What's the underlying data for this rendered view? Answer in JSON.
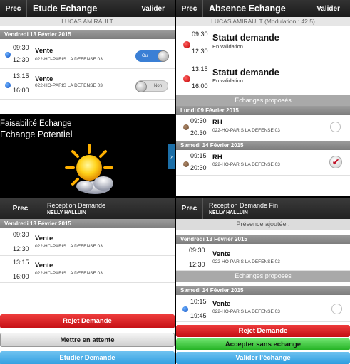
{
  "q1": {
    "prev": "Prec",
    "title": "Etude Echange",
    "validate": "Valider",
    "name": "LUCAS AMIRAULT",
    "day": "Vendredi 13 Février 2015",
    "rows": [
      {
        "t1": "09:30",
        "t2": "12:30",
        "name": "Vente",
        "addr": "022-HO-PARIS LA DEFENSE 03",
        "toggle": "Oui"
      },
      {
        "t1": "13:15",
        "t2": "16:00",
        "name": "Vente",
        "addr": "022-HO-PARIS LA DEFENSE 03",
        "toggle": "Non"
      }
    ]
  },
  "q2": {
    "prev": "Prec",
    "title": "Absence Echange",
    "validate": "Valider",
    "name": "LUCAS AMIRAULT (Modulation : 42.5)",
    "status": [
      {
        "t1": "09:30",
        "t2": "12:30",
        "title": "Statut demande",
        "sub": "En validation"
      },
      {
        "t1": "13:15",
        "t2": "16:00",
        "title": "Statut demande",
        "sub": "En validation"
      }
    ],
    "section": "Echanges proposés",
    "days": [
      {
        "day": "Lundi 09 Février 2015",
        "t1": "09:30",
        "t2": "20:30",
        "name": "RH",
        "addr": "022-HO-PARIS LA DEFENSE 03"
      },
      {
        "day": "Samedi 14 Février 2015",
        "t1": "09:15",
        "t2": "20:30",
        "name": "RH",
        "addr": "022-HO-PARIS LA DEFENSE 03"
      }
    ]
  },
  "q3": {
    "line1": "Faisabilité Echange",
    "line2": "Echange Potentiel",
    "arrow": "›"
  },
  "q4": {
    "prev": "Prec",
    "title": "Reception Demande",
    "person": "NELLY HALLUIN",
    "day": "Vendredi 13 Février 2015",
    "rows": [
      {
        "t1": "09:30",
        "t2": "12:30",
        "name": "Vente",
        "addr": "022-HO-PARIS LA DEFENSE 03"
      },
      {
        "t1": "13:15",
        "t2": "16:00",
        "name": "Vente",
        "addr": "022-HO-PARIS LA DEFENSE 03"
      }
    ],
    "btn_reject": "Rejet Demande",
    "btn_wait": "Mettre en attente",
    "btn_study": "Etudier Demande"
  },
  "q5": {
    "prev": "Prec",
    "title": "Reception Demande Fin",
    "person": "NELLY HALLUIN",
    "presence": "Présence ajoutée :",
    "day1": "Vendredi 13 Février 2015",
    "row1": {
      "t1": "09:30",
      "t2": "12:30",
      "name": "Vente",
      "addr": "022-HO-PARIS LA DEFENSE 03"
    },
    "section": "Echanges proposés",
    "day2": "Samedi 14 Février 2015",
    "row2": {
      "t1": "10:15",
      "t2": "19:45",
      "name": "Vente",
      "addr": "022-HO-PARIS LA DEFENSE 03"
    },
    "btn_reject": "Rejet Demande",
    "btn_accept": "Accepter sans echange",
    "btn_validate": "Valider l'échange"
  },
  "icons": {
    "sun": "sun-cloud-icon",
    "check": "✔"
  },
  "colors": {
    "reject": "#d61e22",
    "study": "#3aa5e6",
    "accept": "#33c033",
    "status_red": "#e00000"
  }
}
